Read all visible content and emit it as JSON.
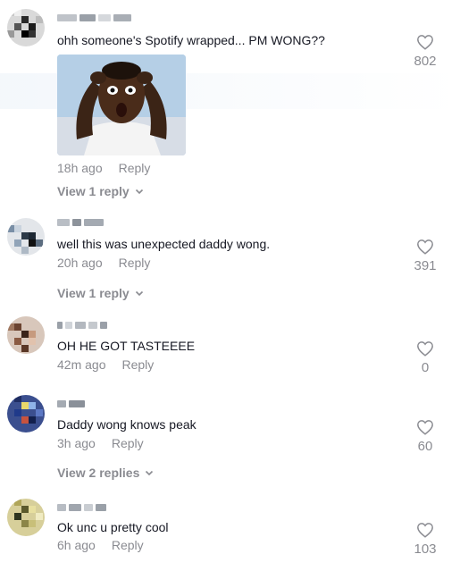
{
  "comments": [
    {
      "text": "ohh someone's Spotify wrapped... PM WONG??",
      "time": "18h ago",
      "reply": "Reply",
      "likes": "802",
      "view_replies": "View 1 reply"
    },
    {
      "text": "well this was unexpected daddy wong.",
      "time": "20h ago",
      "reply": "Reply",
      "likes": "391",
      "view_replies": "View 1 reply"
    },
    {
      "text": "OH HE GOT TASTEEEE",
      "time": "42m ago",
      "reply": "Reply",
      "likes": "0"
    },
    {
      "text": "Daddy wong knows peak",
      "time": "3h ago",
      "reply": "Reply",
      "likes": "60",
      "view_replies": "View 2 replies"
    },
    {
      "text": "Ok unc u pretty cool",
      "time": "6h ago",
      "reply": "Reply",
      "likes": "103"
    }
  ],
  "icons": {
    "like": "heart-outline-icon",
    "expand": "chevron-down-icon"
  },
  "colors": {
    "primary_text": "#161823",
    "secondary_text": "#8a8b91"
  }
}
